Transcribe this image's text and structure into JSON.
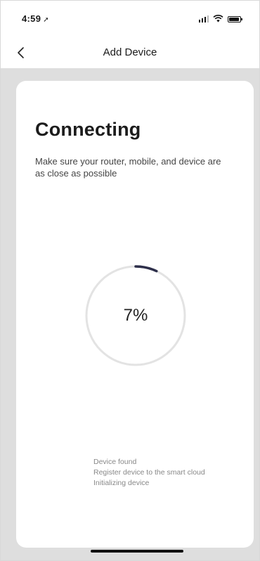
{
  "status_bar": {
    "time": "4:59",
    "location_glyph": "➚",
    "icons": [
      "signal-icon",
      "wifi-icon",
      "battery-icon"
    ]
  },
  "nav": {
    "back_icon": "chevron-left-icon",
    "title": "Add Device"
  },
  "card": {
    "title": "Connecting",
    "subtitle": "Make sure your router, mobile, and device are as close as possible",
    "progress": {
      "percent_label": "7%",
      "value": 0.07,
      "track_color": "#e3e3e3",
      "arc_color": "#2d2f4a"
    },
    "steps": [
      "Device found",
      "Register device to the smart cloud",
      "Initializing device"
    ]
  },
  "colors": {
    "background": "#dedede",
    "card": "#ffffff",
    "text_primary": "#1c1c1c",
    "text_secondary": "#888888"
  }
}
